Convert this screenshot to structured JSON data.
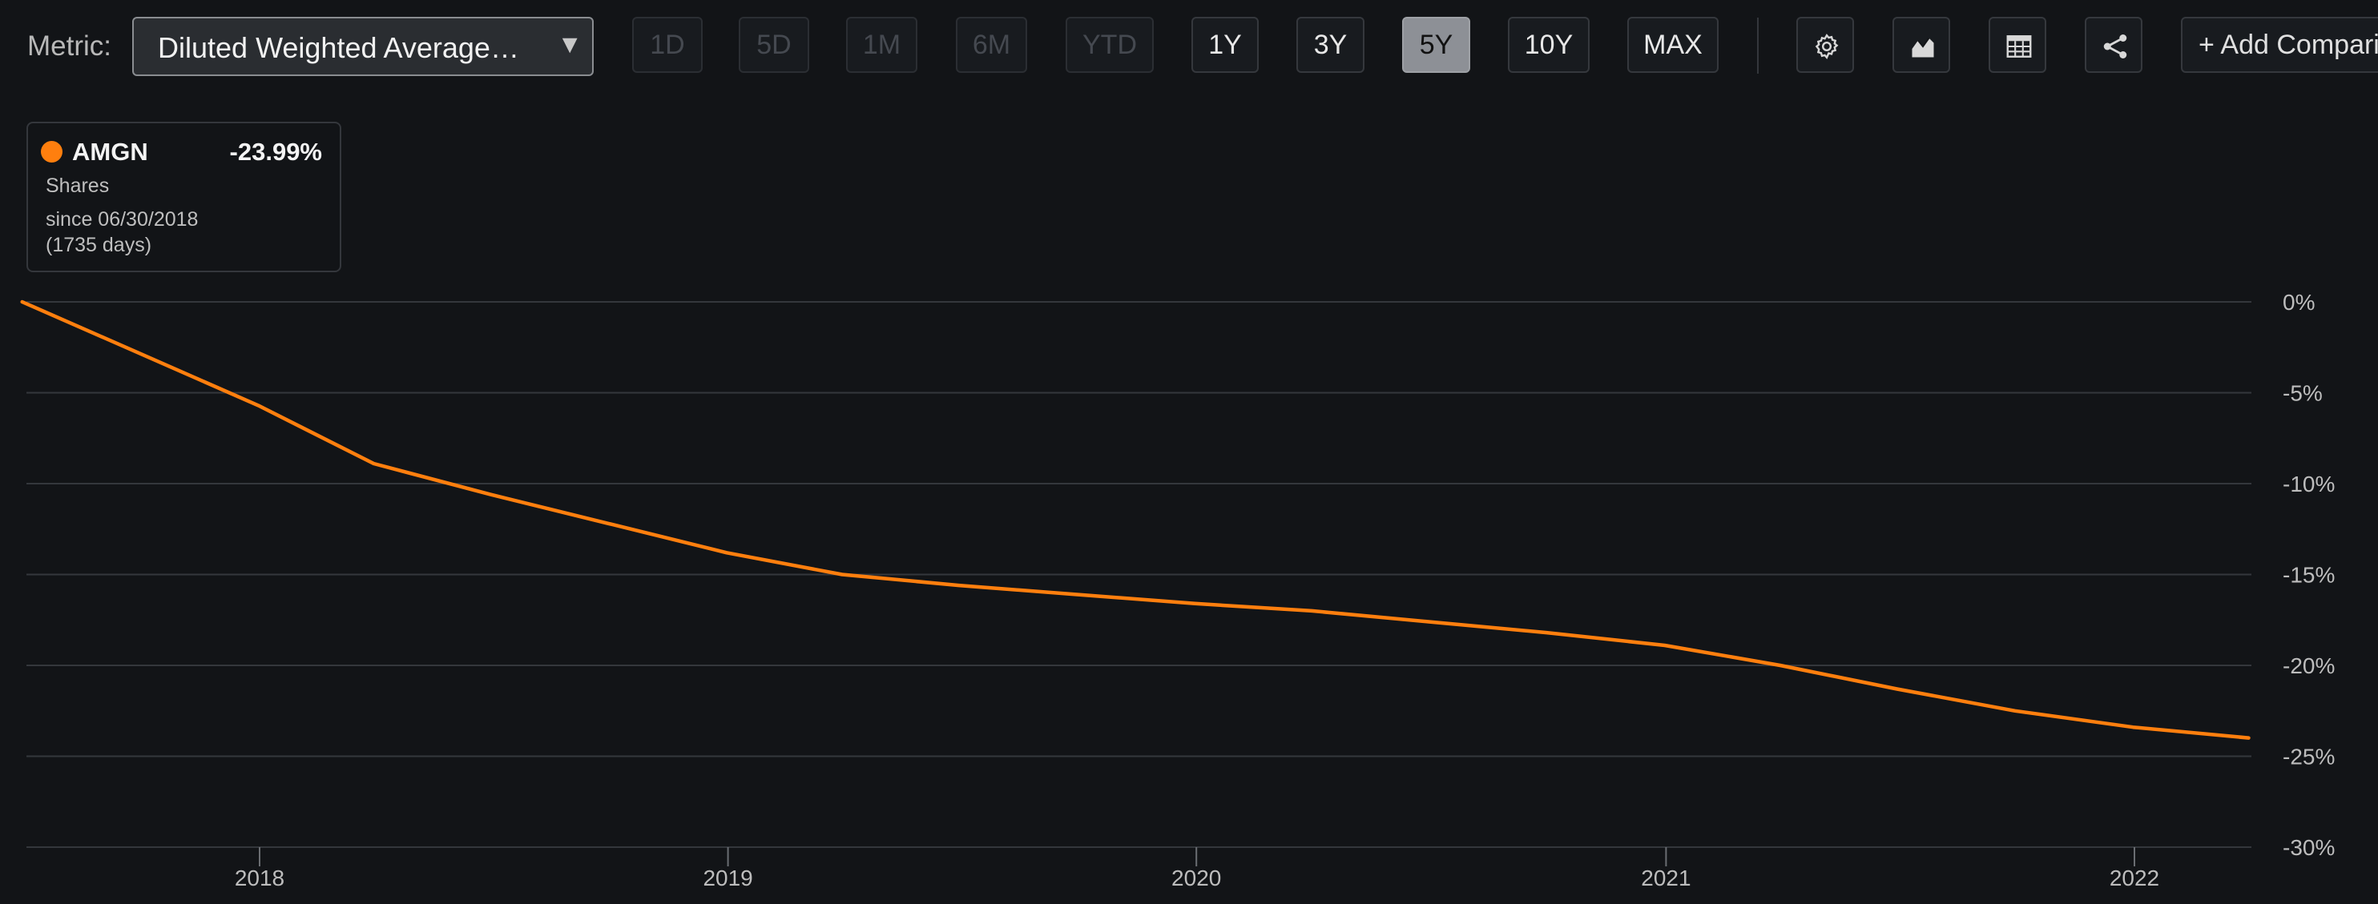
{
  "toolbar": {
    "metric_label": "Metric:",
    "metric_value": "Diluted Weighted Average…",
    "metric_arrow": "▼",
    "ranges": [
      {
        "label": "1D",
        "state": "disabled"
      },
      {
        "label": "5D",
        "state": "disabled"
      },
      {
        "label": "1M",
        "state": "disabled"
      },
      {
        "label": "6M",
        "state": "disabled"
      },
      {
        "label": "YTD",
        "state": "disabled"
      },
      {
        "label": "1Y",
        "state": "enabled"
      },
      {
        "label": "3Y",
        "state": "enabled"
      },
      {
        "label": "5Y",
        "state": "active"
      },
      {
        "label": "10Y",
        "state": "enabled"
      },
      {
        "label": "MAX",
        "state": "enabled"
      }
    ],
    "icons": [
      "settings-icon",
      "chart-type-icon",
      "table-icon",
      "share-icon"
    ],
    "add_comparison": "+ Add Comparison"
  },
  "legend": {
    "ticker": "AMGN",
    "change": "-23.99%",
    "subtitle": "Shares",
    "since": "since 06/30/2018",
    "days": "(1735 days)",
    "color": "#ff7f0e"
  },
  "chart_data": {
    "type": "line",
    "series": [
      {
        "name": "AMGN",
        "color": "#ff7f0e",
        "x": [
          "2017-06-30",
          "2017-12-31",
          "2018-03-31",
          "2018-06-30",
          "2018-09-30",
          "2018-12-31",
          "2019-03-31",
          "2019-06-30",
          "2019-09-30",
          "2019-12-31",
          "2020-03-31",
          "2020-06-30",
          "2020-09-30",
          "2020-12-31",
          "2021-03-31",
          "2021-06-30",
          "2021-09-30",
          "2021-12-31",
          "2022-03-31"
        ],
        "y": [
          0,
          -5.7,
          -8.9,
          -10.6,
          -12.2,
          -13.8,
          -15.0,
          -15.6,
          -16.1,
          -16.6,
          -17.0,
          -17.6,
          -18.2,
          -18.9,
          -20.0,
          -21.3,
          -22.5,
          -23.4,
          -23.99
        ]
      }
    ],
    "x_ticks": [
      "2018",
      "2019",
      "2020",
      "2021",
      "2022"
    ],
    "y_ticks": [
      "0%",
      "-5%",
      "-10%",
      "-15%",
      "-20%",
      "-25%",
      "-30%"
    ],
    "ylim": [
      -30,
      0
    ],
    "grid": true,
    "y_axis_side": "right"
  }
}
